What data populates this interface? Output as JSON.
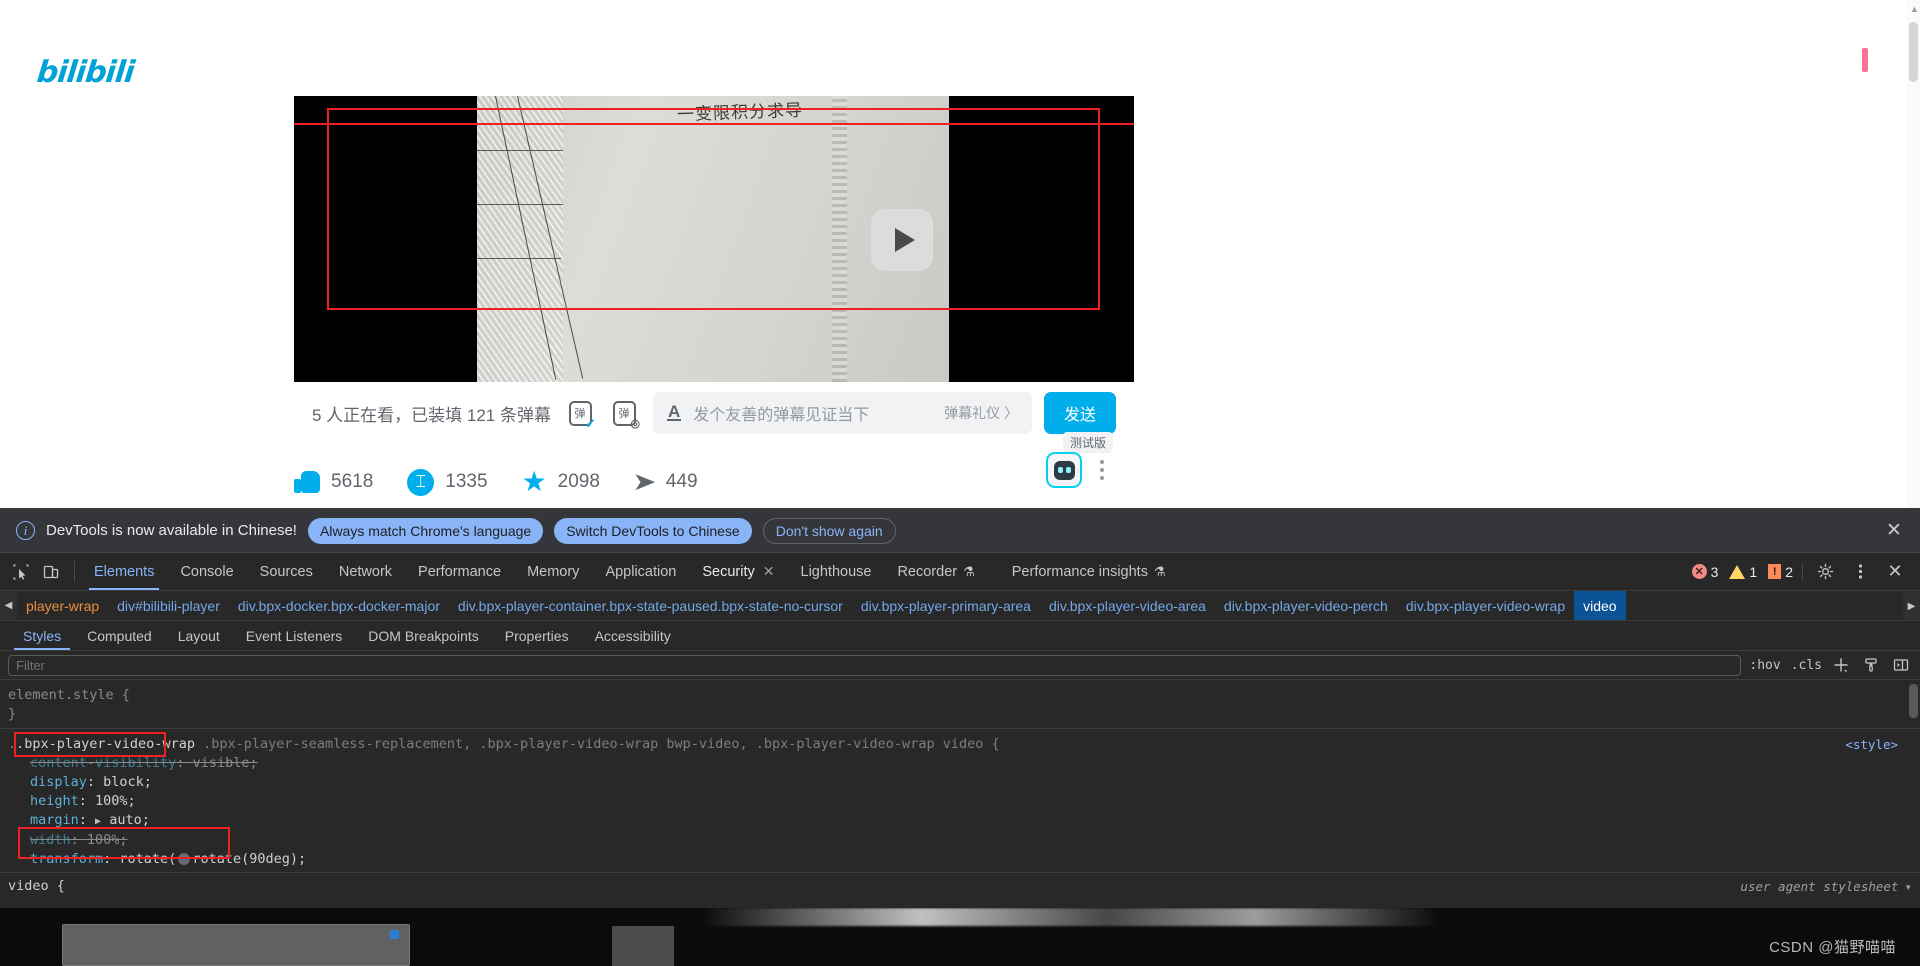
{
  "site": {
    "logo_text": "bilibili",
    "brand_color": "#00a1d6"
  },
  "player": {
    "video_caption": "一变限积分求导",
    "play_icon": "play-icon"
  },
  "danmaku": {
    "count_text": "5 人正在看，已装填 121 条弹幕",
    "glyph": "弹",
    "input_placeholder": "发个友善的弹幕见证当下",
    "etiquette_label": "弹幕礼仪 〉",
    "send_label": "发送",
    "text_style_icon": "A"
  },
  "actions": [
    {
      "icon": "thumbs-up-icon",
      "name": "like",
      "count": "5618"
    },
    {
      "icon": "coin-icon",
      "name": "coin",
      "count": "1335"
    },
    {
      "icon": "star-icon",
      "name": "favorite",
      "count": "2098"
    },
    {
      "icon": "share-icon",
      "name": "share",
      "count": "449"
    }
  ],
  "ai_button": {
    "badge": "测试版",
    "icon": "ai-robot-icon"
  },
  "devtools": {
    "banner": {
      "icon": "info-icon",
      "message": "DevTools is now available in Chinese!",
      "buttons": [
        {
          "label": "Always match Chrome's language",
          "style": "filled"
        },
        {
          "label": "Switch DevTools to Chinese",
          "style": "filled"
        },
        {
          "label": "Don't show again",
          "style": "outline"
        }
      ],
      "close_icon": "close-icon"
    },
    "toolbar_icons": [
      {
        "name": "inspect-element-icon"
      },
      {
        "name": "device-toolbar-icon"
      }
    ],
    "tabs": [
      {
        "label": "Elements",
        "active": true
      },
      {
        "label": "Console",
        "active": false
      },
      {
        "label": "Sources",
        "active": false
      },
      {
        "label": "Network",
        "active": false
      },
      {
        "label": "Performance",
        "active": false
      },
      {
        "label": "Memory",
        "active": false
      },
      {
        "label": "Application",
        "active": false
      },
      {
        "label": "Security",
        "active": false,
        "closable": true
      },
      {
        "label": "Lighthouse",
        "active": false
      },
      {
        "label": "Recorder",
        "active": false,
        "experimental": true
      },
      {
        "label": "Performance insights",
        "active": false,
        "experimental": true
      }
    ],
    "status_counts": {
      "errors": "3",
      "warnings": "1",
      "infos": "2"
    },
    "right_icons": [
      {
        "name": "settings-gear-icon"
      },
      {
        "name": "more-options-icon"
      },
      {
        "name": "close-devtools-icon"
      }
    ],
    "breadcrumbs": [
      {
        "label": "player-wrap",
        "selected": false,
        "first": true
      },
      {
        "label": "div#bilibili-player",
        "selected": false
      },
      {
        "label": "div.bpx-docker.bpx-docker-major",
        "selected": false
      },
      {
        "label": "div.bpx-player-container.bpx-state-paused.bpx-state-no-cursor",
        "selected": false
      },
      {
        "label": "div.bpx-player-primary-area",
        "selected": false
      },
      {
        "label": "div.bpx-player-video-area",
        "selected": false
      },
      {
        "label": "div.bpx-player-video-perch",
        "selected": false
      },
      {
        "label": "div.bpx-player-video-wrap",
        "selected": false
      },
      {
        "label": "video",
        "selected": true
      }
    ],
    "sub_tabs": [
      {
        "label": "Styles",
        "active": true
      },
      {
        "label": "Computed",
        "active": false
      },
      {
        "label": "Layout",
        "active": false
      },
      {
        "label": "Event Listeners",
        "active": false
      },
      {
        "label": "DOM Breakpoints",
        "active": false
      },
      {
        "label": "Properties",
        "active": false
      },
      {
        "label": "Accessibility",
        "active": false
      }
    ],
    "filter": {
      "placeholder": "Filter",
      "value": "",
      "hov_label": ":hov",
      "cls_label": ".cls",
      "new_rule_icon": "plus-icon",
      "class_icon": "paint-brush-icon",
      "sidebar_icon": "toggle-sidebar-icon"
    },
    "styles": {
      "element_style": {
        "selector": "element.style {",
        "close": "}"
      },
      "rule1": {
        "selector_highlighted": ".bpx-player-video-wrap",
        "selector_rest": " .bpx-player-seamless-replacement, .bpx-player-video-wrap bwp-video, .bpx-player-video-wrap video {",
        "source": "<style>",
        "close": "}",
        "declarations": [
          {
            "prop": "content-visibility",
            "value": "visible;",
            "struck": true
          },
          {
            "prop": "display",
            "value": "block;",
            "struck": false
          },
          {
            "prop": "height",
            "value": "100%;",
            "struck": false
          },
          {
            "prop": "margin",
            "value": "auto;",
            "struck": false,
            "expandable": true
          },
          {
            "prop": "width",
            "value": "100%;",
            "struck": true
          },
          {
            "prop": "transform",
            "value": "rotate(90deg);",
            "struck": false,
            "swatch": true
          }
        ]
      },
      "rule2": {
        "selector": "video {",
        "source": "user agent stylesheet"
      }
    }
  },
  "watermark": "CSDN @猫野喵喵"
}
